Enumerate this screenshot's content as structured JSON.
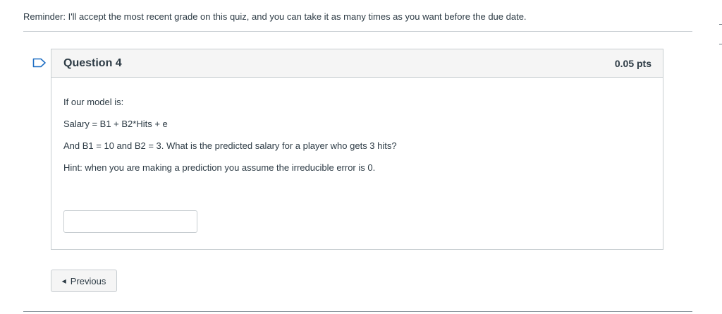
{
  "reminder": "Reminder: I'll accept the most recent grade on this quiz, and you can take it as many times as you want before the due date.",
  "question": {
    "title": "Question 4",
    "points": "0.05 pts",
    "lines": [
      "If our model is:",
      "Salary = B1 + B2*Hits + e",
      "And B1 = 10 and B2 = 3. What is the predicted salary for a player who gets 3 hits?",
      "Hint: when you are making a prediction you assume the irreducible error is 0."
    ],
    "answer_value": ""
  },
  "navigation": {
    "previous_label": "Previous",
    "previous_icon": "caret-left-icon"
  },
  "icons": {
    "flag": "flag-question-icon"
  },
  "colors": {
    "text": "#2d3b45",
    "border": "#c7cdd1",
    "header_bg": "#f5f5f5"
  }
}
